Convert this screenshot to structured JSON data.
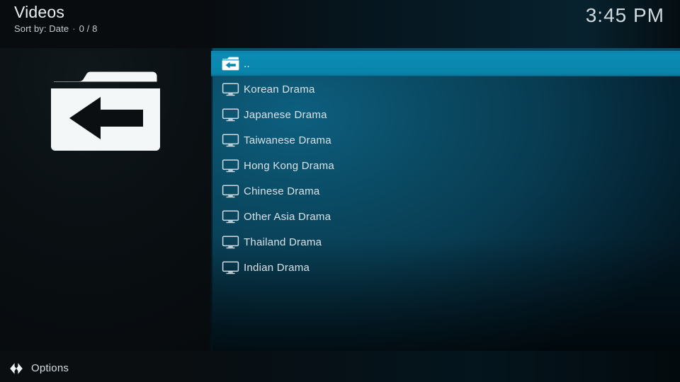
{
  "window": {
    "title": "Videos",
    "sort_label": "Sort by: Date",
    "separator": "·",
    "count_label": "0 / 8",
    "clock": "3:45 PM"
  },
  "preview": {
    "icon": "folder-back-icon"
  },
  "list": {
    "items": [
      {
        "label": "..",
        "icon": "folder-back-icon",
        "selected": true
      },
      {
        "label": "Korean Drama",
        "icon": "tv-icon",
        "selected": false
      },
      {
        "label": "Japanese Drama",
        "icon": "tv-icon",
        "selected": false
      },
      {
        "label": "Taiwanese Drama",
        "icon": "tv-icon",
        "selected": false
      },
      {
        "label": "Hong Kong Drama",
        "icon": "tv-icon",
        "selected": false
      },
      {
        "label": "Chinese Drama",
        "icon": "tv-icon",
        "selected": false
      },
      {
        "label": "Other Asia Drama",
        "icon": "tv-icon",
        "selected": false
      },
      {
        "label": "Thailand Drama",
        "icon": "tv-icon",
        "selected": false
      },
      {
        "label": "Indian Drama",
        "icon": "tv-icon",
        "selected": false
      }
    ]
  },
  "footer": {
    "options_label": "Options",
    "options_icon": "left-right-arrows-icon"
  },
  "colors": {
    "selection": "#0a89b0",
    "panel_teal": "#0a4a63",
    "background_dark": "#0a1013",
    "text_primary": "#e8eef1",
    "text_secondary": "#c3ccd2"
  }
}
